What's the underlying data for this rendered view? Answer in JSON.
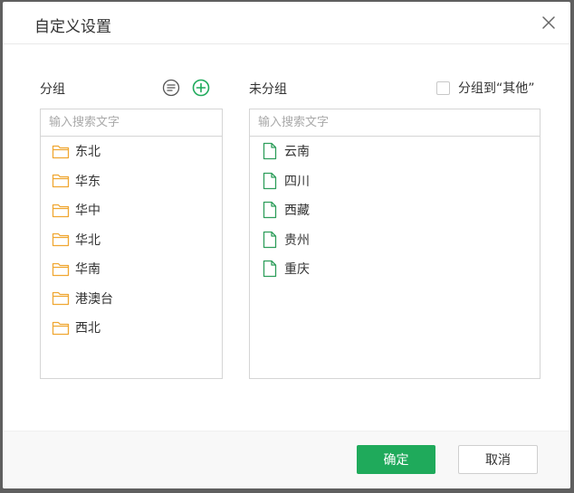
{
  "dialog": {
    "title": "自定义设置",
    "close_icon": "close-icon"
  },
  "grouped": {
    "label": "分组",
    "sort_icon": "sort-list-icon",
    "add_icon": "add-circle-icon",
    "search_placeholder": "输入搜索文字",
    "item_icon": "folder-icon",
    "items": [
      "东北",
      "华东",
      "华中",
      "华北",
      "华南",
      "港澳台",
      "西北"
    ]
  },
  "ungrouped": {
    "label": "未分组",
    "checkbox_label": "分组到“其他”",
    "search_placeholder": "输入搜索文字",
    "item_icon": "document-icon",
    "items": [
      "云南",
      "四川",
      "西藏",
      "贵州",
      "重庆"
    ]
  },
  "footer": {
    "ok_label": "确定",
    "cancel_label": "取消"
  },
  "colors": {
    "accent": "#1faa5b",
    "folder": "#f0a732",
    "document": "#2e9e5b"
  }
}
